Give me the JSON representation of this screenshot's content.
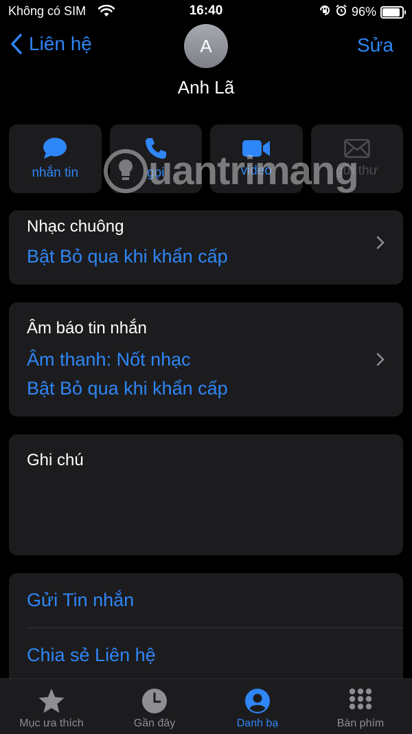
{
  "status_bar": {
    "carrier": "Không có SIM",
    "time": "16:40",
    "battery": "96%",
    "battery_level": 0.96
  },
  "nav": {
    "back_label": "Liên hệ",
    "edit_label": "Sửa"
  },
  "contact": {
    "initial": "A",
    "name": "Anh Lã"
  },
  "actions": [
    {
      "label": "nhắn tin",
      "icon": "message-icon",
      "enabled": true
    },
    {
      "label": "gọi",
      "icon": "phone-icon",
      "enabled": true
    },
    {
      "label": "video",
      "icon": "video-icon",
      "enabled": true
    },
    {
      "label": "gửi thư",
      "icon": "mail-icon",
      "enabled": false
    }
  ],
  "ringtone": {
    "title": "Nhạc chuông",
    "value": "Bật Bỏ qua khi khẩn cấp"
  },
  "text_tone": {
    "title": "Âm báo tin nhắn",
    "sound": "Âm thanh: Nốt nhạc",
    "bypass": "Bật Bỏ qua khi khẩn cấp"
  },
  "notes": {
    "title": "Ghi chú"
  },
  "links": {
    "send_message": "Gửi Tin nhắn",
    "share_contact": "Chia sẻ Liên hệ"
  },
  "watermark": {
    "text": "uantrimang"
  },
  "tabs": [
    {
      "label": "Mục ưa thích",
      "icon": "star-icon",
      "active": false
    },
    {
      "label": "Gần đây",
      "icon": "clock-icon",
      "active": false
    },
    {
      "label": "Danh bạ",
      "icon": "contacts-icon",
      "active": true
    },
    {
      "label": "Bàn phím",
      "icon": "keypad-icon",
      "active": false
    }
  ],
  "colors": {
    "accent": "#2f86f6",
    "background": "#000000",
    "card": "#1c1c1e",
    "inactive": "#8e8e93"
  }
}
